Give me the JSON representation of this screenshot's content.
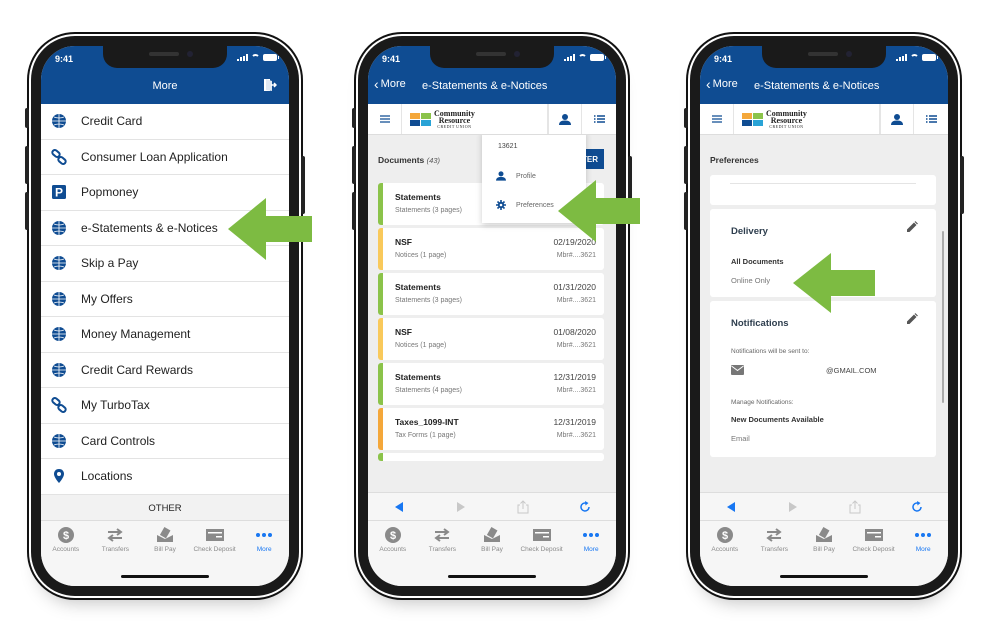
{
  "status": {
    "time": "9:41"
  },
  "phone1": {
    "nav_title": "More",
    "menu_items": [
      {
        "label": "Credit Card",
        "icon": "globe-lock-icon"
      },
      {
        "label": "Consumer Loan Application",
        "icon": "link-icon"
      },
      {
        "label": "Popmoney",
        "icon": "popmoney-icon"
      },
      {
        "label": "e-Statements & e-Notices",
        "icon": "globe-lock-icon"
      },
      {
        "label": "Skip a Pay",
        "icon": "globe-lock-icon"
      },
      {
        "label": "My Offers",
        "icon": "globe-lock-icon"
      },
      {
        "label": "Money Management",
        "icon": "globe-lock-icon"
      },
      {
        "label": "Credit Card Rewards",
        "icon": "globe-lock-icon"
      },
      {
        "label": "My TurboTax",
        "icon": "link-icon"
      },
      {
        "label": "Card Controls",
        "icon": "globe-lock-icon"
      },
      {
        "label": "Locations",
        "icon": "location-pin-icon"
      }
    ],
    "section_label": "OTHER"
  },
  "tabbar": {
    "tabs": [
      {
        "label": "Accounts",
        "icon": "dollar-icon"
      },
      {
        "label": "Transfers",
        "icon": "transfer-arrows-icon"
      },
      {
        "label": "Bill Pay",
        "icon": "bill-pay-icon"
      },
      {
        "label": "Check Deposit",
        "icon": "check-icon"
      },
      {
        "label": "More",
        "icon": "more-dots-icon",
        "active": true
      }
    ]
  },
  "secondary_nav": {
    "back_label": "More",
    "title": "e-Statements & e-Notices"
  },
  "logo": {
    "line1": "Community",
    "line2": "Resource",
    "line3": "CREDIT UNION"
  },
  "phone2": {
    "documents_label": "Documents",
    "documents_count": "(43)",
    "filter_label": "TER",
    "dropdown": {
      "account": "13621",
      "options": [
        {
          "label": "Profile",
          "icon": "person-icon"
        },
        {
          "label": "Preferences",
          "icon": "gear-icon"
        }
      ]
    },
    "documents": [
      {
        "title": "Statements",
        "subtitle": "Statements (3 pages)",
        "date": "",
        "member": "",
        "type": "statement"
      },
      {
        "title": "NSF",
        "subtitle": "Notices (1 page)",
        "date": "02/19/2020",
        "member": "Mbr#....3621",
        "type": "notice"
      },
      {
        "title": "Statements",
        "subtitle": "Statements (3 pages)",
        "date": "01/31/2020",
        "member": "Mbr#....3621",
        "type": "statement"
      },
      {
        "title": "NSF",
        "subtitle": "Notices (1 page)",
        "date": "01/08/2020",
        "member": "Mbr#....3621",
        "type": "notice"
      },
      {
        "title": "Statements",
        "subtitle": "Statements (4 pages)",
        "date": "12/31/2019",
        "member": "Mbr#....3621",
        "type": "statement"
      },
      {
        "title": "Taxes_1099-INT",
        "subtitle": "Tax Forms (1 page)",
        "date": "12/31/2019",
        "member": "Mbr#....3621",
        "type": "tax"
      }
    ]
  },
  "phone3": {
    "section_title": "Preferences",
    "delivery": {
      "heading": "Delivery",
      "label": "All Documents",
      "value": "Online Only"
    },
    "notifications": {
      "heading": "Notifications",
      "sent_to_label": "Notifications will be sent to:",
      "email": "@GMAIL.COM",
      "manage_label": "Manage Notifications:",
      "item_label": "New Documents Available",
      "item_value": "Email"
    }
  },
  "colors": {
    "brand_blue": "#0f4c92",
    "arrow_green": "#7dbb42",
    "statement_green": "#8bc34a",
    "notice_yellow": "#f9c95b",
    "tax_orange": "#f4a73a",
    "active_blue": "#1877f2"
  }
}
